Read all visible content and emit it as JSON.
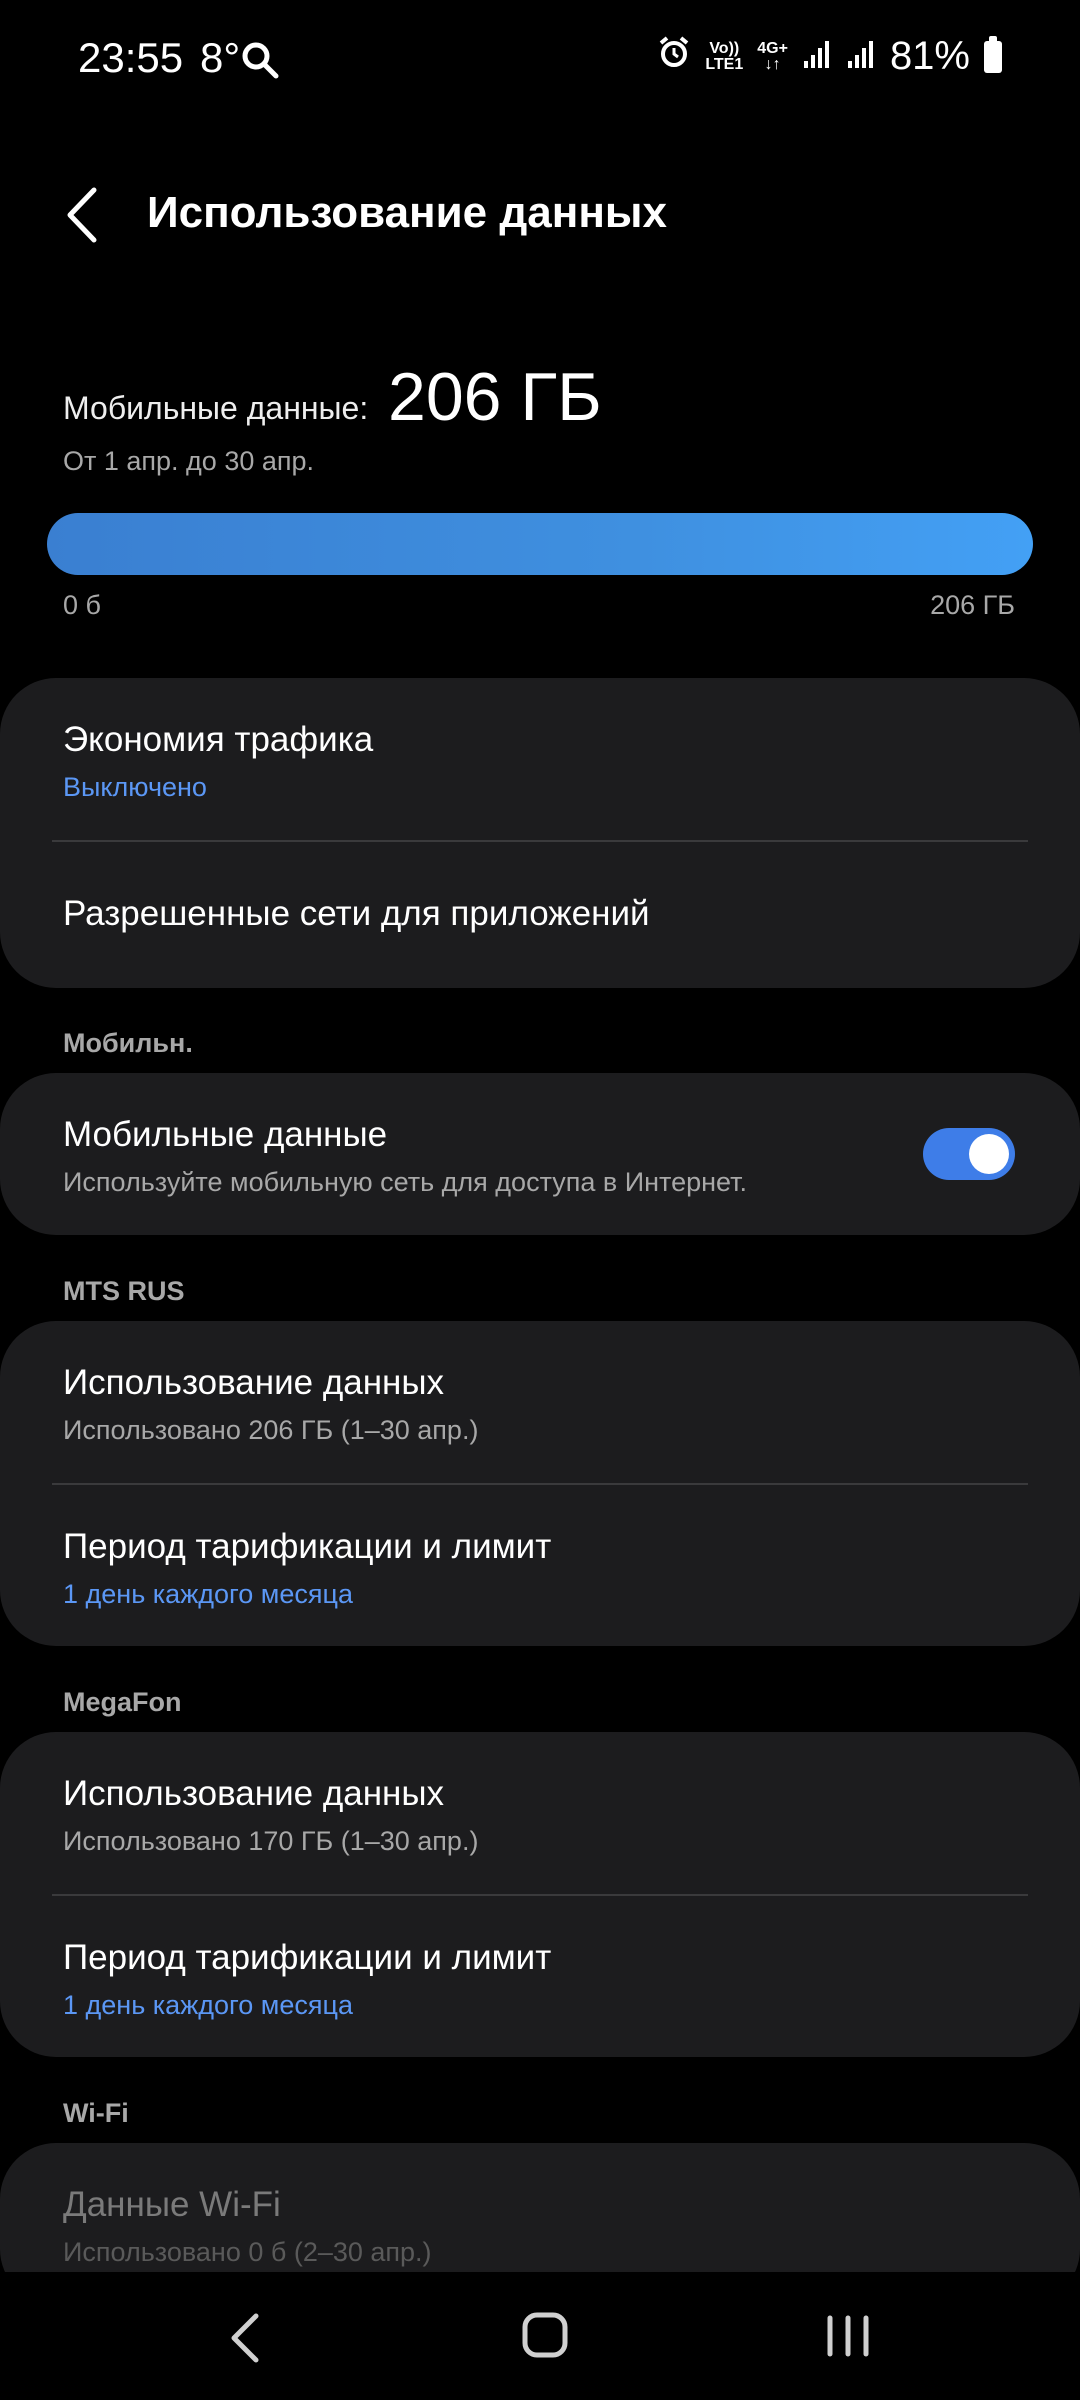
{
  "status": {
    "time": "23:55",
    "temp": "8°",
    "net_top": "Vo))",
    "net_bottom": "LTE1",
    "gen": "4G+",
    "battery": "81%"
  },
  "header": {
    "title": "Использование данных"
  },
  "usage": {
    "label": "Мобильные данные:",
    "value": "206 ГБ",
    "period": "От 1 апр. до 30 апр.",
    "bar_min": "0 б",
    "bar_max": "206 ГБ",
    "fill_fraction": 1.0
  },
  "card1": {
    "saver_title": "Экономия трафика",
    "saver_status": "Выключено",
    "allowed_title": "Разрешенные сети для приложений"
  },
  "section_mobile": "Мобильн.",
  "mobile": {
    "title": "Мобильные данные",
    "subtitle": "Используйте мобильную сеть для доступа в Интернет.",
    "enabled": true
  },
  "section_mts": "MTS RUS",
  "mts": {
    "usage_title": "Использование данных",
    "usage_sub": "Использовано 206 ГБ (1–30 апр.)",
    "period_title": "Период тарификации и лимит",
    "period_sub": "1 день каждого месяца"
  },
  "section_megafon": "MegaFon",
  "megafon": {
    "usage_title": "Использование данных",
    "usage_sub": "Использовано 170 ГБ (1–30 апр.)",
    "period_title": "Период тарификации и лимит",
    "period_sub": "1 день каждого месяца"
  },
  "section_wifi": "Wi-Fi",
  "wifi": {
    "title": "Данные Wi-Fi",
    "sub": "Использовано 0 б (2–30 апр.)"
  },
  "colors": {
    "accent": "#3e7de8",
    "link": "#5b97f5",
    "card_bg": "#1c1c1e"
  }
}
